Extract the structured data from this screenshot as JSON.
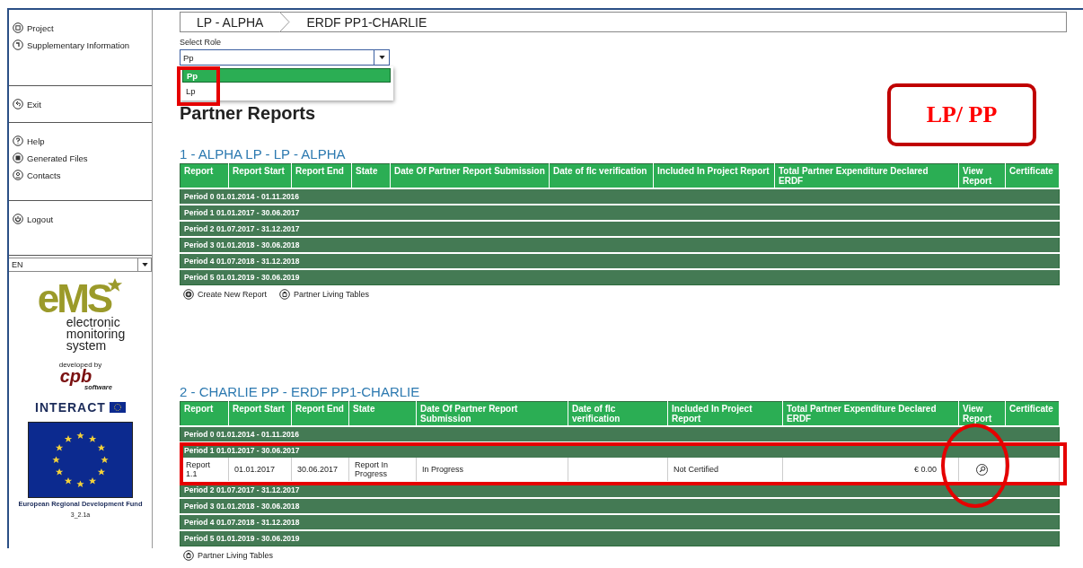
{
  "sidebar": {
    "groups": [
      [
        {
          "label": "Project"
        },
        {
          "label": "Supplementary Information"
        }
      ],
      [
        {
          "label": "Exit"
        }
      ],
      [
        {
          "label": "Help"
        },
        {
          "label": "Generated Files"
        },
        {
          "label": "Contacts"
        }
      ],
      [
        {
          "label": "Logout"
        }
      ]
    ],
    "language": "EN",
    "logo": {
      "mark": "eMS",
      "lines": [
        "electronic",
        "monitoring",
        "system"
      ],
      "developed_by": "developed by",
      "company": "cpb",
      "company_sub": "software",
      "partner": "INTERACT",
      "fund": "European Regional Development Fund",
      "version": "3_2.1a"
    }
  },
  "breadcrumb": [
    "LP - ALPHA",
    "ERDF PP1-CHARLIE"
  ],
  "role_select": {
    "label": "Select Role",
    "value": "Pp",
    "expanded": true,
    "options": [
      {
        "label": "Pp",
        "selected": true
      },
      {
        "label": "Lp",
        "selected": false
      }
    ]
  },
  "heading": "Partner Reports",
  "sections": [
    {
      "title": "1 - ALPHA LP - LP - ALPHA",
      "columns": [
        "Report",
        "Report Start",
        "Report End",
        "State",
        "Date Of Partner Report Submission",
        "Date of flc verification",
        "Included In Project Report",
        "Total Partner Expenditure Declared ERDF",
        "View Report",
        "Certificate"
      ],
      "rows": [
        {
          "kind": "period",
          "label": "Period 0 01.01.2014 - 01.11.2016"
        },
        {
          "kind": "period",
          "label": "Period 1 01.01.2017 - 30.06.2017"
        },
        {
          "kind": "period",
          "label": "Period 2 01.07.2017 - 31.12.2017"
        },
        {
          "kind": "period",
          "label": "Period 3 01.01.2018 - 30.06.2018"
        },
        {
          "kind": "period",
          "label": "Period 4 01.07.2018 - 31.12.2018"
        },
        {
          "kind": "period",
          "label": "Period 5 01.01.2019 - 30.06.2019"
        }
      ],
      "actions": [
        {
          "label": "Create New Report"
        },
        {
          "label": "Partner Living Tables"
        }
      ]
    },
    {
      "title": "2 - CHARLIE PP - ERDF PP1-CHARLIE",
      "columns": [
        "Report",
        "Report Start",
        "Report End",
        "State",
        "Date Of Partner Report Submission",
        "Date of flc verification",
        "Included In Project Report",
        "Total Partner Expenditure Declared ERDF",
        "View Report",
        "Certificate"
      ],
      "rows": [
        {
          "kind": "period",
          "label": "Period 0 01.01.2014 - 01.11.2016"
        },
        {
          "kind": "period",
          "label": "Period 1 01.01.2017 - 30.06.2017"
        },
        {
          "kind": "report",
          "cells": [
            "Report 1.1",
            "01.01.2017",
            "30.06.2017",
            "Report In Progress",
            "In Progress",
            "",
            "Not Certified",
            "€ 0.00"
          ],
          "view": true
        },
        {
          "kind": "period",
          "label": "Period 2 01.07.2017 - 31.12.2017"
        },
        {
          "kind": "period",
          "label": "Period 3 01.01.2018 - 30.06.2018"
        },
        {
          "kind": "period",
          "label": "Period 4 01.07.2018 - 31.12.2018"
        },
        {
          "kind": "period",
          "label": "Period 5 01.01.2019 - 30.06.2019"
        }
      ],
      "actions": [
        {
          "label": "Partner Living Tables"
        }
      ]
    }
  ],
  "annotations": [
    {
      "kind": "box"
    },
    {
      "kind": "callout",
      "text": "LP/ PP"
    },
    {
      "kind": "box"
    },
    {
      "kind": "ellipse"
    }
  ]
}
